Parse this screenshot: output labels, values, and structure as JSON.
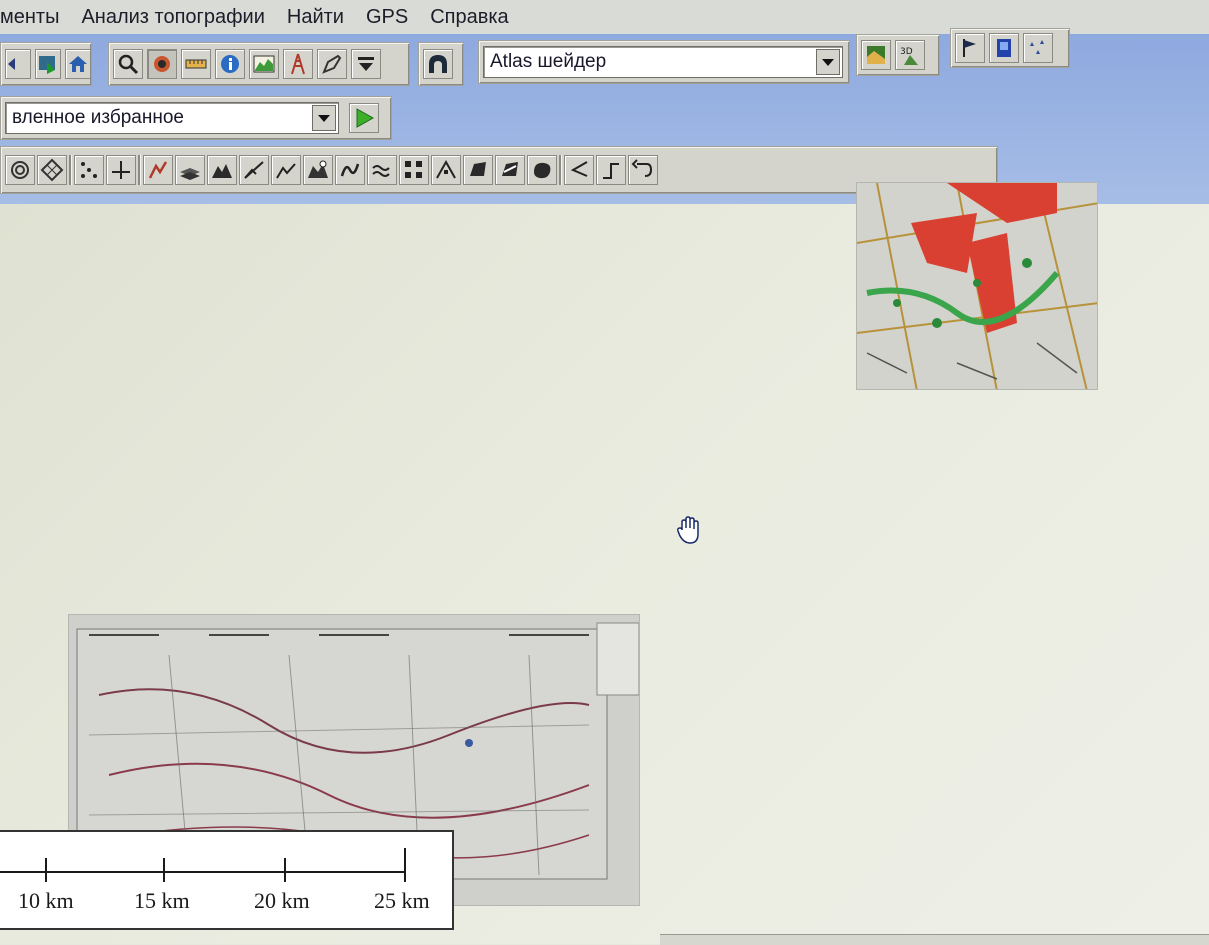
{
  "menu": {
    "items": [
      {
        "label": "менты"
      },
      {
        "label": "Анализ топографии"
      },
      {
        "label": "Найти"
      },
      {
        "label": "GPS"
      },
      {
        "label": "Справка"
      }
    ]
  },
  "toolbar": {
    "shader_select": {
      "value": "Atlas шейдер"
    },
    "favorites_select": {
      "value": "вленное избранное"
    }
  },
  "scale_bar": {
    "labels": [
      "10 km",
      "15 km",
      "20 km",
      "25 km"
    ]
  },
  "colors": {
    "band_blue": "#8ea9df",
    "toolbar_gray": "#d4d4cc",
    "canvas_bg": "#e6e8dd",
    "play_green": "#3fae2a"
  }
}
